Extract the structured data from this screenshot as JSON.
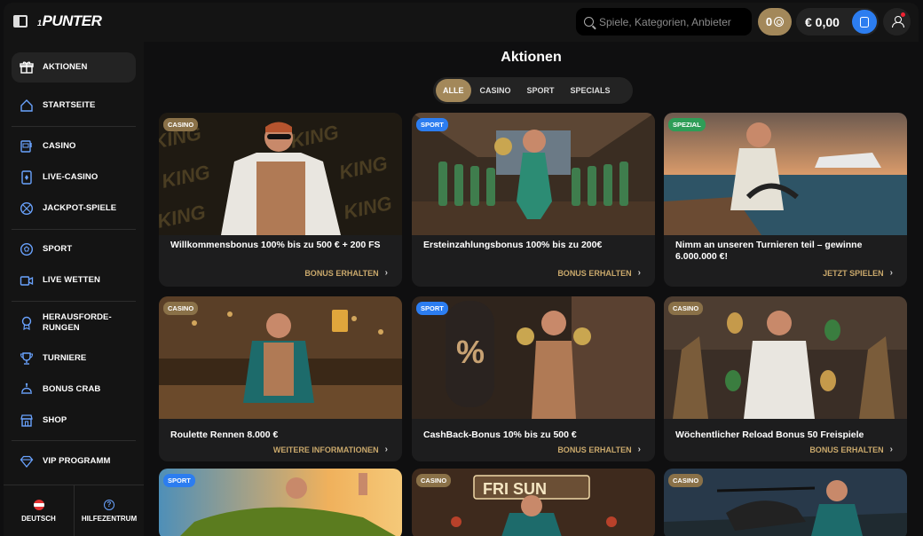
{
  "header": {
    "logo_prefix": "1",
    "logo_text": "PUNTER",
    "search_placeholder": "Spiele, Kategorien, Anbieter",
    "coins_value": "0",
    "balance": "€ 0,00"
  },
  "sidebar": {
    "items": [
      {
        "label": "AKTIONEN",
        "icon": "gift-icon",
        "active": true
      },
      {
        "label": "STARTSEITE",
        "icon": "home-icon"
      },
      {
        "label": "CASINO",
        "icon": "slot-machine-icon"
      },
      {
        "label": "LIVE-CASINO",
        "icon": "card-icon"
      },
      {
        "label": "JACKPOT-SPIELE",
        "icon": "jackpot-icon"
      },
      {
        "label": "SPORT",
        "icon": "football-icon"
      },
      {
        "label": "LIVE WETTEN",
        "icon": "live-camera-icon"
      },
      {
        "label": "HERAUSFORDE-\nRUNGEN",
        "icon": "challenge-icon"
      },
      {
        "label": "TURNIERE",
        "icon": "trophy-icon"
      },
      {
        "label": "BONUS CRAB",
        "icon": "crab-icon"
      },
      {
        "label": "SHOP",
        "icon": "shop-icon"
      },
      {
        "label": "VIP PROGRAMM",
        "icon": "diamond-icon"
      }
    ],
    "footer": {
      "language": "DEUTSCH",
      "help": "HILFEZENTRUM"
    }
  },
  "main": {
    "title": "Aktionen",
    "filters": [
      "ALLE",
      "CASINO",
      "SPORT",
      "SPECIALS"
    ],
    "active_filter": "ALLE",
    "cards": [
      {
        "badge": "CASINO",
        "title": "Willkommensbonus 100% bis zu 500 € + 200 FS",
        "cta": "BONUS ERHALTEN"
      },
      {
        "badge": "SPORT",
        "title": "Ersteinzahlungsbonus 100% bis zu 200€",
        "cta": "BONUS ERHALTEN"
      },
      {
        "badge": "SPEZIAL",
        "title": "Nimm an unseren Turnieren teil – gewinne 6.000.000 €!",
        "cta": "JETZT SPIELEN"
      },
      {
        "badge": "CASINO",
        "title": "Roulette Rennen 8.000 €",
        "cta": "WEITERE INFORMATIONEN"
      },
      {
        "badge": "SPORT",
        "title": "CashBack-Bonus 10% bis zu 500 €",
        "cta": "BONUS ERHALTEN"
      },
      {
        "badge": "CASINO",
        "title": "Wöchentlicher Reload Bonus 50 Freispiele",
        "cta": "BONUS ERHALTEN"
      },
      {
        "badge": "SPORT",
        "title": "",
        "cta": ""
      },
      {
        "badge": "CASINO",
        "title": "",
        "cta": ""
      },
      {
        "badge": "CASINO",
        "title": "",
        "cta": ""
      }
    ],
    "image_text": {
      "king_words": "KING",
      "percent_sign": "%",
      "fri_sun_sign": "FRI SUN"
    }
  },
  "colors": {
    "accent_gold": "#a3885a",
    "cta_gold": "#c9a86b",
    "blue": "#2c7df0",
    "green": "#2e9d57",
    "bg": "#0f0f10",
    "panel": "#141414"
  }
}
